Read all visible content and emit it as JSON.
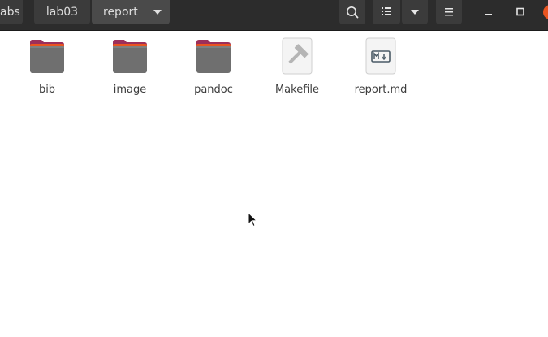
{
  "breadcrumbs": [
    "abs",
    "lab03",
    "report"
  ],
  "header": {
    "search_icon": "search-icon",
    "view_icon": "list-view-icon",
    "view_dropdown_icon": "chevron-down-icon",
    "menu_icon": "hamburger-menu-icon",
    "minimize_icon": "minimize-icon",
    "maximize_icon": "maximize-icon",
    "close_icon": "close-icon"
  },
  "files": [
    {
      "name": "bib",
      "type": "folder"
    },
    {
      "name": "image",
      "type": "folder"
    },
    {
      "name": "pandoc",
      "type": "folder"
    },
    {
      "name": "Makefile",
      "type": "makefile"
    },
    {
      "name": "report.md",
      "type": "markdown"
    }
  ],
  "colors": {
    "header_bg": "#2c2c2c",
    "folder_tab": "#e95420",
    "folder_back": "#9c2f5a",
    "folder_body": "#6f6f6f",
    "accent": "#e95420"
  }
}
